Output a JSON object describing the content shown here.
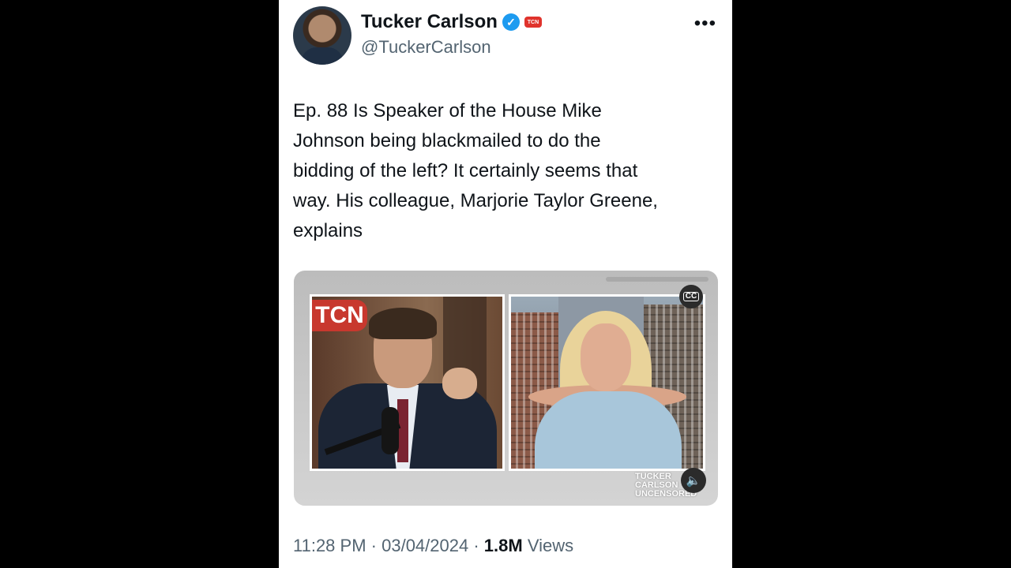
{
  "author": {
    "name": "Tucker Carlson",
    "handle": "@TuckerCarlson",
    "affiliation_badge": "TCN"
  },
  "menu": {
    "more_label": "•••"
  },
  "tweet": {
    "text": "Ep. 88  Is Speaker of the House Mike\nJohnson being blackmailed to do the\nbidding of the left? It certainly seems that\nway. His colleague, Marjorie Taylor Greene,\nexplains"
  },
  "media": {
    "left_sign": "TCN",
    "cc_label": "CC",
    "watermark": [
      "TUCKER",
      "CARLSON",
      "UNCENSORED"
    ],
    "volume_icon": "🔈"
  },
  "meta": {
    "time": "11:28 PM",
    "separator": " · ",
    "date": "03/04/2024",
    "views_count": "1.8M",
    "views_label": " Views"
  },
  "colors": {
    "verified": "#1d9bf0",
    "text": "#0f1419",
    "muted": "#536471"
  },
  "icons": [
    "verified-badge-icon",
    "more-icon",
    "cc-icon",
    "volume-icon"
  ]
}
